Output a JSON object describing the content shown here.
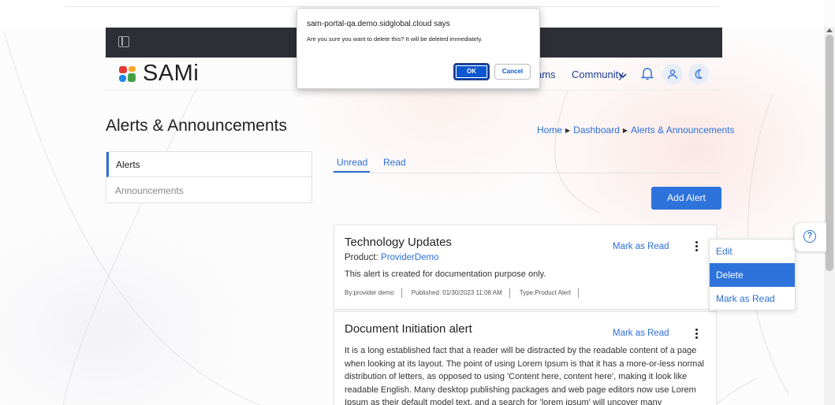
{
  "dialog": {
    "title": "sam-portal-qa.demo.sidglobal.cloud says",
    "message": "Are you sure you want to delete this? It will be deleted immediately.",
    "ok_label": "OK",
    "cancel_label": "Cancel"
  },
  "header": {
    "logo_text": "SAMi",
    "nav_partial": "ams",
    "nav_community": "Community",
    "icons": [
      "sidebar-toggle-icon",
      "bell-icon",
      "user-icon",
      "moon-icon"
    ]
  },
  "page": {
    "title": "Alerts & Announcements",
    "breadcrumb": [
      "Home",
      "Dashboard",
      "Alerts & Announcements"
    ]
  },
  "left_menu": {
    "items": [
      {
        "label": "Alerts",
        "active": true
      },
      {
        "label": "Announcements",
        "active": false
      }
    ]
  },
  "tabs": [
    {
      "label": "Unread",
      "active": true
    },
    {
      "label": "Read",
      "active": false
    }
  ],
  "add_alert_label": "Add Alert",
  "alerts": [
    {
      "title": "Technology Updates",
      "product_label": "Product:",
      "product_name": "ProviderDemo",
      "description": "This alert is created for documentation purpose only.",
      "by": "By:provider demo",
      "published": "Published: 01/30/2023 11:08 AM",
      "type": "Type:Product Alert",
      "mark_read_label": "Mark as Read"
    },
    {
      "title": "Document Initiation alert",
      "mark_read_label": "Mark as Read",
      "body": "It is a long established fact that a reader will be distracted by the readable content of a page when looking at its layout. The point of using Lorem Ipsum is that it has a more-or-less normal distribution of letters, as opposed to using 'Content here, content here', making it look like readable English. Many desktop publishing packages and web page editors now use Lorem Ipsum as their default model text, and a search for 'lorem ipsum' will uncover many"
    }
  ],
  "dropdown": {
    "items": [
      "Edit",
      "Delete",
      "Mark as Read"
    ],
    "highlighted": "Delete"
  },
  "help_icon": "question-circle-icon",
  "colors": {
    "accent": "#2e73dc",
    "link": "#2e6fd6",
    "dark_bar": "#2d2f36",
    "dialog_ok": "#0b57d0"
  }
}
